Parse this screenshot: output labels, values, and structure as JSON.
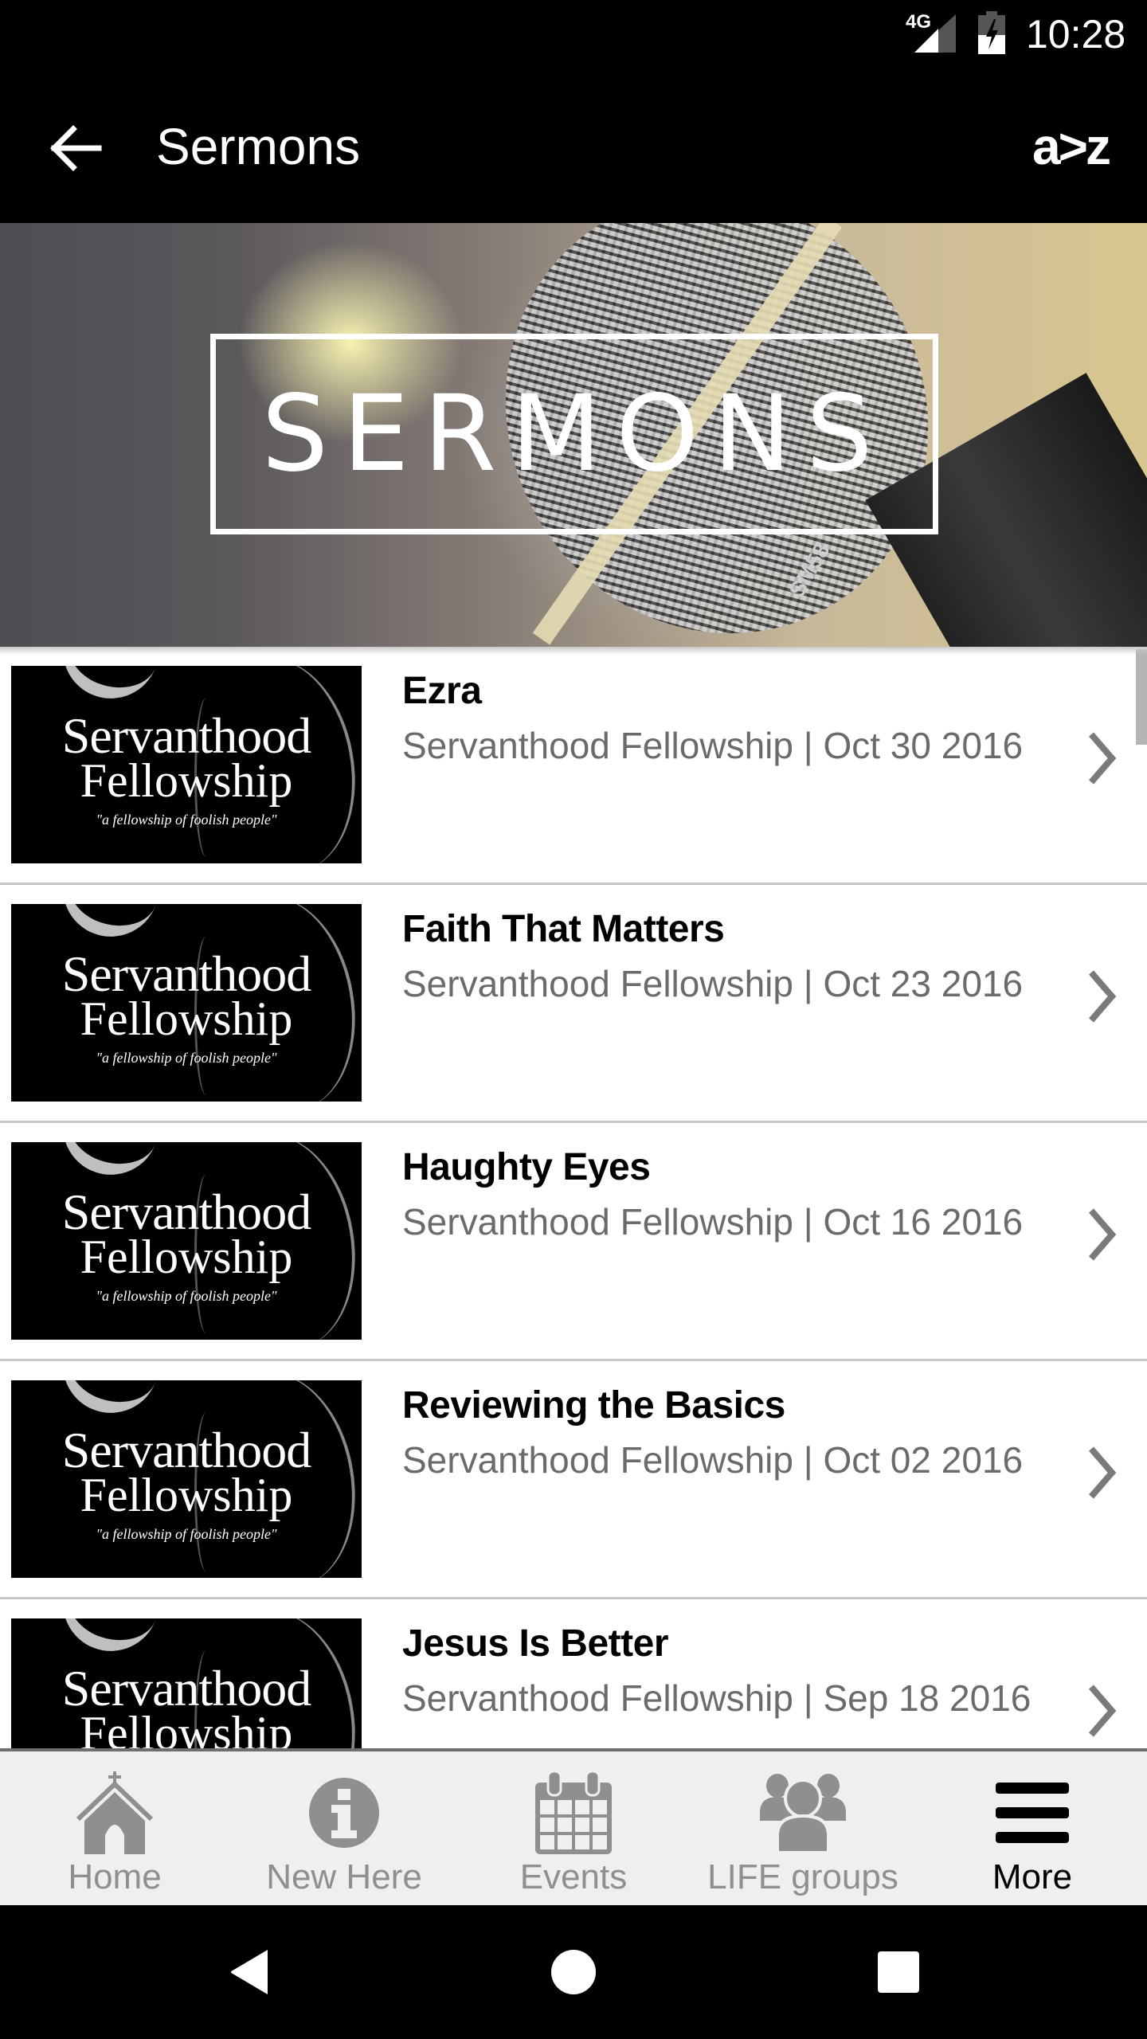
{
  "status_bar": {
    "network": "4G",
    "time": "10:28"
  },
  "app_bar": {
    "title": "Sermons",
    "sort_label": "a>z"
  },
  "banner": {
    "title": "SERMONS",
    "mic_label": "SM58"
  },
  "thumbnail": {
    "line1": "Servanthood",
    "line2": "Fellowship",
    "tagline": "\"a fellowship of foolish people\""
  },
  "sermons": [
    {
      "title": "Ezra",
      "subtitle": "Servanthood Fellowship | Oct 30 2016"
    },
    {
      "title": "Faith That Matters",
      "subtitle": "Servanthood Fellowship | Oct 23 2016"
    },
    {
      "title": "Haughty Eyes",
      "subtitle": "Servanthood Fellowship | Oct 16 2016"
    },
    {
      "title": "Reviewing the Basics",
      "subtitle": "Servanthood Fellowship | Oct 02 2016"
    },
    {
      "title": "Jesus Is Better",
      "subtitle": "Servanthood Fellowship | Sep 18 2016"
    }
  ],
  "bottom_nav": {
    "tabs": [
      {
        "label": "Home",
        "icon": "church-icon",
        "active": false
      },
      {
        "label": "New Here",
        "icon": "info-icon",
        "active": false
      },
      {
        "label": "Events",
        "icon": "calendar-icon",
        "active": false
      },
      {
        "label": "LIFE groups",
        "icon": "group-icon",
        "active": false
      },
      {
        "label": "More",
        "icon": "menu-icon",
        "active": true
      }
    ]
  },
  "colors": {
    "app_bar_bg": "#000000",
    "subtitle_text": "#6b6b6b",
    "nav_inactive": "#8f8f8f",
    "nav_active": "#000000",
    "nav_bg": "#efefef"
  }
}
